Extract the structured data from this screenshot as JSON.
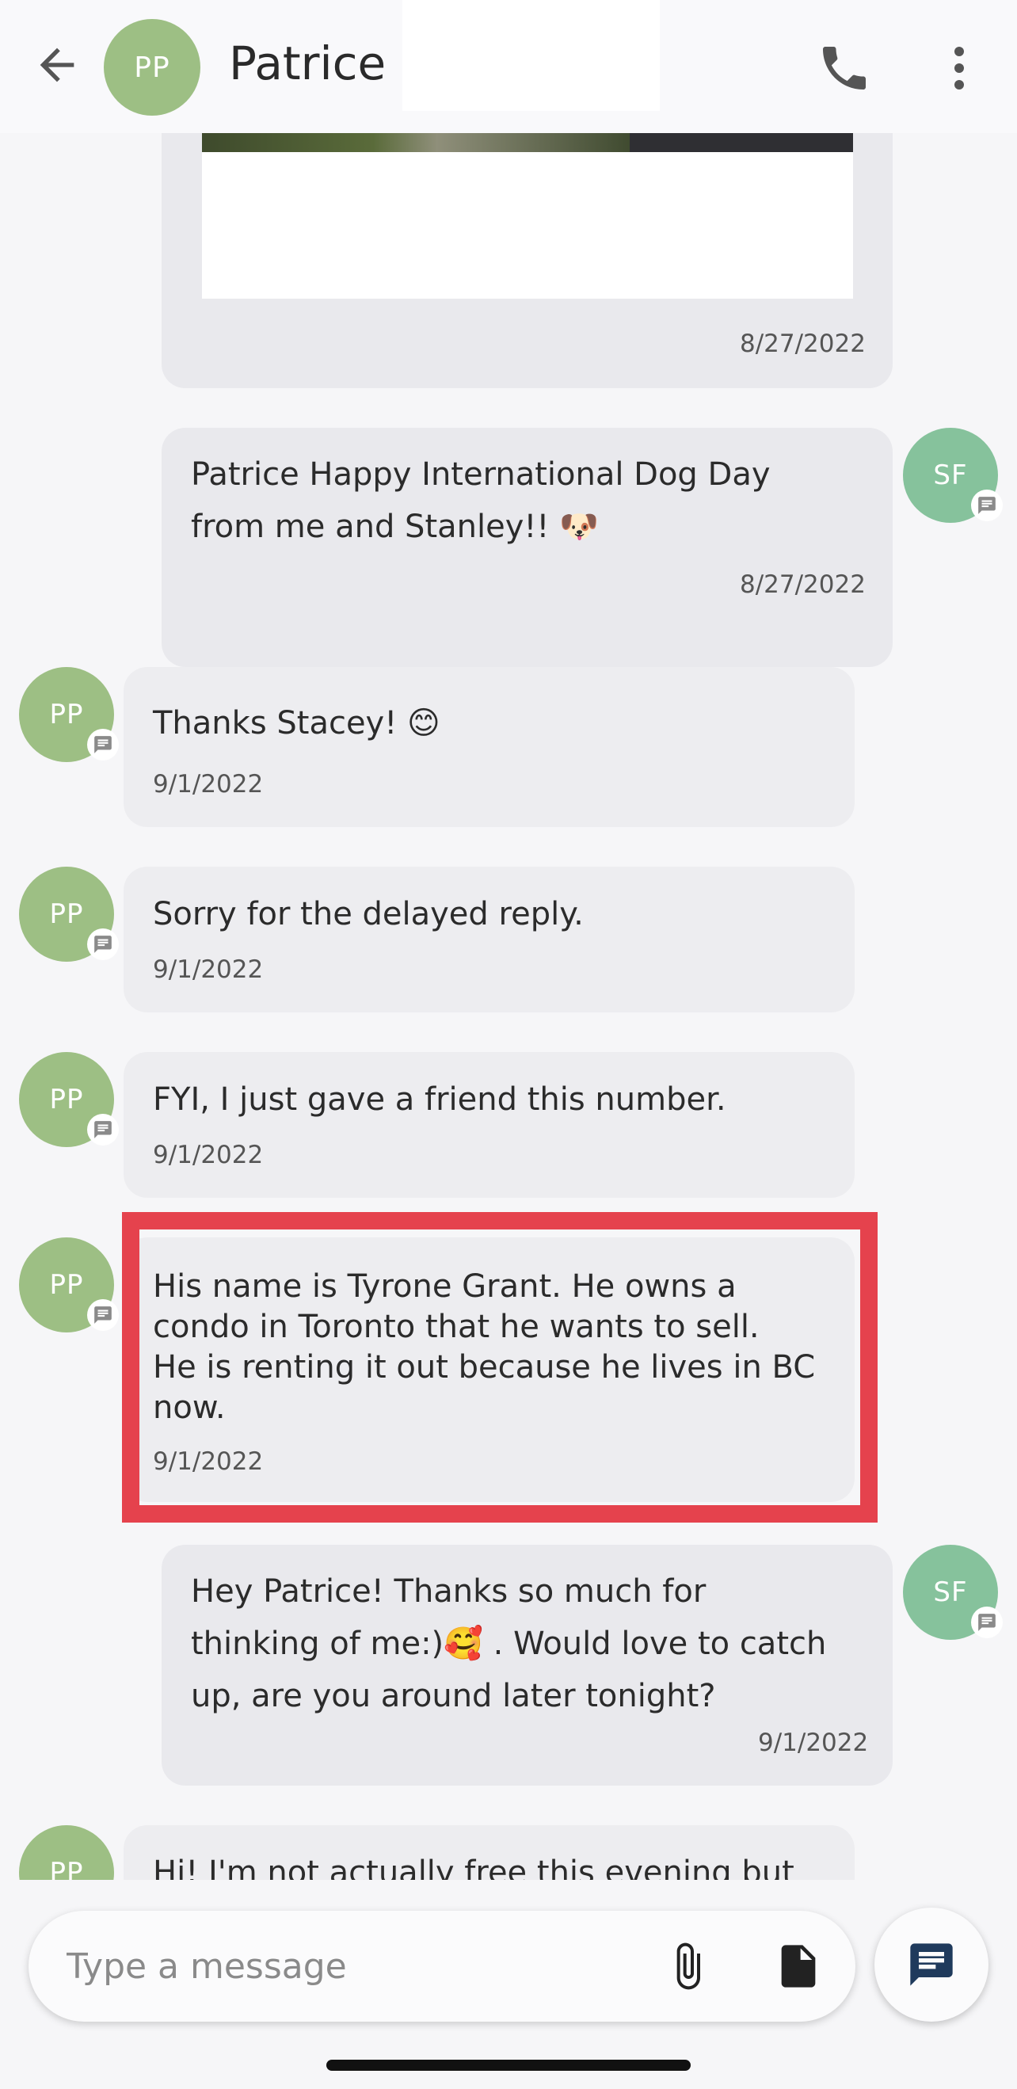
{
  "header": {
    "avatar_initials": "PP",
    "contact_name": "Patrice"
  },
  "messages": [
    {
      "id": "m0",
      "direction": "outgoing",
      "type": "image",
      "date": "8/27/2022"
    },
    {
      "id": "m1",
      "direction": "outgoing",
      "sender_initials": "SF",
      "text_line1": "Patrice Happy International Dog Day",
      "text_line2": "from me and Stanley!! 🐶",
      "date": "8/27/2022"
    },
    {
      "id": "m2",
      "direction": "incoming",
      "sender_initials": "PP",
      "text": "Thanks Stacey! 😊",
      "date": "9/1/2022"
    },
    {
      "id": "m3",
      "direction": "incoming",
      "sender_initials": "PP",
      "text": "Sorry for the delayed reply.",
      "date": "9/1/2022"
    },
    {
      "id": "m4",
      "direction": "incoming",
      "sender_initials": "PP",
      "text": "FYI,  I just gave a friend this number.",
      "date": "9/1/2022"
    },
    {
      "id": "m5",
      "direction": "incoming",
      "sender_initials": "PP",
      "highlighted": true,
      "text_line1": "His name is Tyrone Grant. He owns a",
      "text_line2": "condo in Toronto that he wants to sell.",
      "text_line3": "He is renting it out because he lives in BC",
      "text_line4": "now.",
      "date": "9/1/2022"
    },
    {
      "id": "m6",
      "direction": "outgoing",
      "sender_initials": "SF",
      "text_line1": "Hey Patrice!  Thanks so much for",
      "text_line2": "thinking of me:)🥰 . Would love to catch",
      "text_line3": "up, are you around later tonight?",
      "date": "9/1/2022"
    },
    {
      "id": "m7",
      "direction": "incoming",
      "sender_initials": "PP",
      "text": "Hi! I'm not actually free this evening but"
    }
  ],
  "composer": {
    "placeholder": "Type a message"
  },
  "colors": {
    "pp_avatar": "#9dbf84",
    "sf_avatar": "#86c29c",
    "highlight": "#e5424d",
    "send_icon": "#1f3a5c"
  },
  "icons": {
    "back": "arrow-left-icon",
    "call": "phone-icon",
    "more": "more-vertical-icon",
    "badge": "chat-bubble-icon",
    "attach": "paperclip-icon",
    "document": "document-icon",
    "send": "message-icon"
  }
}
